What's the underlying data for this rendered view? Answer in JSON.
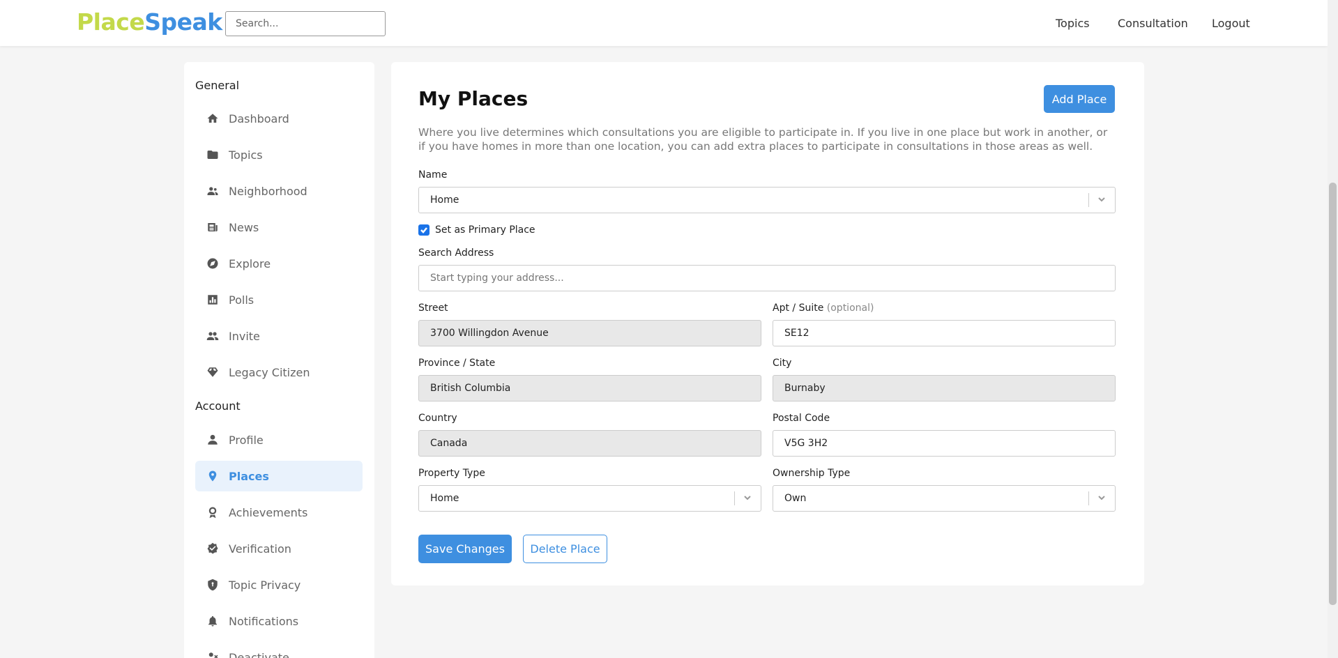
{
  "header": {
    "logo_part1": "Place",
    "logo_part2": "Speak",
    "search_placeholder": "Search...",
    "nav": {
      "topics": "Topics",
      "consultation": "Consultation",
      "logout": "Logout"
    }
  },
  "sidebar": {
    "general_title": "General",
    "account_title": "Account",
    "general_items": [
      {
        "label": "Dashboard",
        "icon": "home-icon"
      },
      {
        "label": "Topics",
        "icon": "folder-icon"
      },
      {
        "label": "Neighborhood",
        "icon": "people-icon"
      },
      {
        "label": "News",
        "icon": "newspaper-icon"
      },
      {
        "label": "Explore",
        "icon": "compass-icon"
      },
      {
        "label": "Polls",
        "icon": "bar-chart-icon"
      },
      {
        "label": "Invite",
        "icon": "group-icon"
      },
      {
        "label": "Legacy Citizen",
        "icon": "diamond-icon"
      }
    ],
    "account_items": [
      {
        "label": "Profile",
        "icon": "person-icon"
      },
      {
        "label": "Places",
        "icon": "location-pin-icon",
        "active": true
      },
      {
        "label": "Achievements",
        "icon": "award-icon"
      },
      {
        "label": "Verification",
        "icon": "verified-badge-icon"
      },
      {
        "label": "Topic Privacy",
        "icon": "shield-icon"
      },
      {
        "label": "Notifications",
        "icon": "bell-icon"
      },
      {
        "label": "Deactivate",
        "icon": "person-remove-icon"
      }
    ]
  },
  "main": {
    "title": "My Places",
    "add_place": "Add Place",
    "description": "Where you live determines which consultations you are eligible to participate in. If you live in one place but work in another, or if you have homes in more than one location, you can add extra places to participate in consultations in those areas as well.",
    "name_label": "Name",
    "name_value": "Home",
    "primary_label": "Set as Primary Place",
    "primary_checked": true,
    "search_address_label": "Search Address",
    "search_address_placeholder": "Start typing your address...",
    "street_label": "Street",
    "street_value": "3700 Willingdon Avenue",
    "apt_label": "Apt / Suite",
    "apt_optional": "(optional)",
    "apt_value": "SE12",
    "province_label": "Province / State",
    "province_value": "British Columbia",
    "city_label": "City",
    "city_value": "Burnaby",
    "country_label": "Country",
    "country_value": "Canada",
    "postal_label": "Postal Code",
    "postal_value": "V5G 3H2",
    "property_type_label": "Property Type",
    "property_type_value": "Home",
    "ownership_type_label": "Ownership Type",
    "ownership_type_value": "Own",
    "save_changes": "Save Changes",
    "delete_place": "Delete Place"
  },
  "colors": {
    "brand_green": "#c3d94a",
    "brand_blue": "#3e8fe0",
    "active_bg": "#e9f2fc"
  }
}
